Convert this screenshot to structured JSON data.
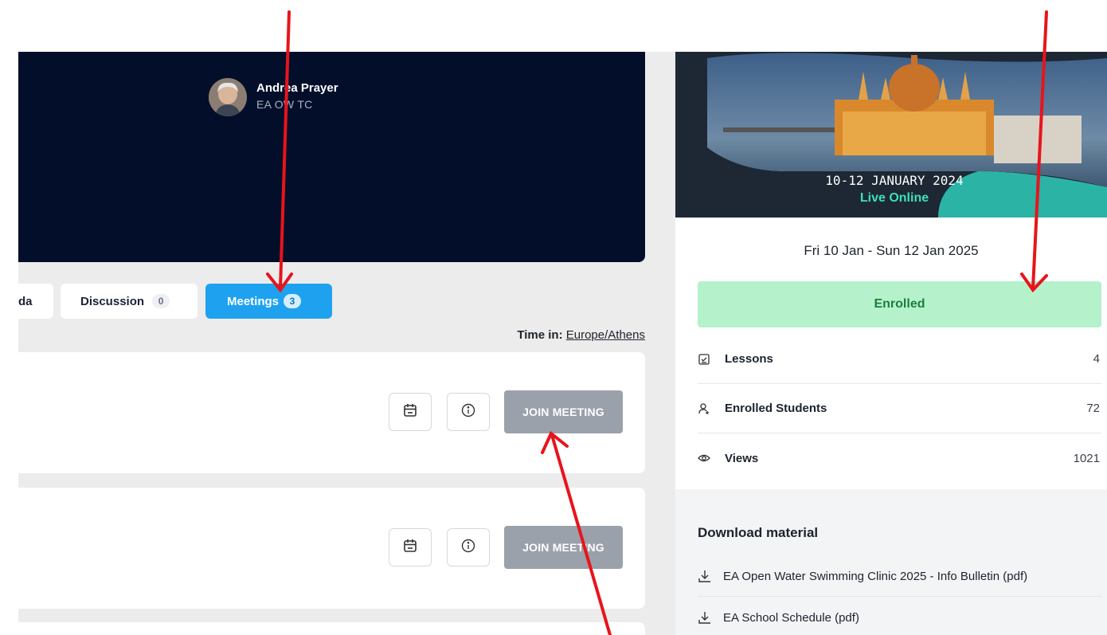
{
  "instructor": {
    "name": "Andrea Prayer",
    "role": "EA OW TC"
  },
  "tabs": [
    {
      "label": "da",
      "count": null,
      "active": false
    },
    {
      "label": "Discussion",
      "count": "0",
      "active": false
    },
    {
      "label": "Meetings",
      "count": "3",
      "active": true
    }
  ],
  "timezone": {
    "prefix": "Time in:",
    "value": "Europe/Athens"
  },
  "meetings": [
    {
      "join_label": "JOIN MEETING"
    },
    {
      "join_label": "JOIN MEETING"
    }
  ],
  "banner": {
    "dates": "10-12 JANUARY 2024",
    "mode": "Live Online"
  },
  "course": {
    "date_range": "Fri 10 Jan - Sun 12 Jan 2025",
    "enroll_status": "Enrolled",
    "stats": [
      {
        "icon": "lessons-icon",
        "label": "Lessons",
        "value": "4"
      },
      {
        "icon": "students-icon",
        "label": "Enrolled Students",
        "value": "72"
      },
      {
        "icon": "eye-icon",
        "label": "Views",
        "value": "1021"
      }
    ]
  },
  "downloads": {
    "title": "Download material",
    "items": [
      {
        "label": "EA Open Water Swimming Clinic 2025 - Info Bulletin (pdf)"
      },
      {
        "label": "EA School Schedule (pdf)"
      }
    ]
  },
  "colors": {
    "accent": "#1ea2ef",
    "hero_bg": "#030f2a",
    "enrolled_bg": "#b5f2cc",
    "enrolled_text": "#1b7f3d",
    "join_disabled": "#9aa1ab",
    "annotation_arrow": "#e8141b"
  }
}
